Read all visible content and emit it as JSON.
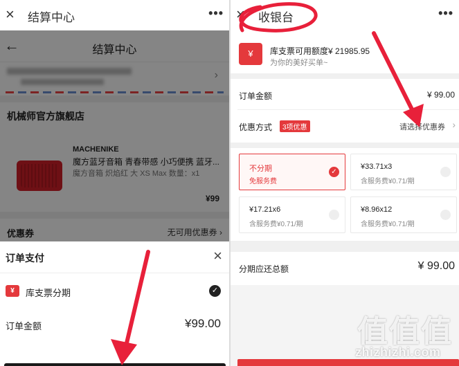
{
  "left": {
    "topbar": {
      "close_icon": "×",
      "title": "结算中心",
      "more_icon": "•••"
    },
    "header": {
      "back_icon": "←",
      "title": "结算中心"
    },
    "address": {
      "chevron": "›"
    },
    "shop_name": "机械师官方旗舰店",
    "product": {
      "brand": "MACHENIKE",
      "name": "魔方蓝牙音箱 青春带感 小巧便携 蓝牙...",
      "spec": "魔方音箱 炽焰红 大 XS Max    数量：x1",
      "price": "¥99"
    },
    "coupon": {
      "label": "优惠券",
      "value": "无可用优惠券 ›"
    },
    "payment_sheet": {
      "title": "订单支付",
      "close_icon": "×",
      "method_icon": "¥",
      "method": "库支票分期",
      "check_icon": "✓",
      "order_label": "订单金额",
      "order_amount": "¥99.00"
    }
  },
  "right": {
    "topbar": {
      "close_icon": "×",
      "title": "收银台",
      "more_icon": "•••"
    },
    "cashier": {
      "icon": "¥",
      "credit_text": "库支票可用额度¥ 21985.95",
      "subtitle": "为你的美好买单~"
    },
    "order_label": "订单金额",
    "order_amount": "¥ 99.00",
    "discount_label": "优惠方式",
    "discount_badge": "3项优惠",
    "discount_select": "请选择优惠券",
    "discount_chevron": "›",
    "plans": [
      {
        "title": "不分期",
        "sub": "免服务费",
        "selected": true,
        "radio": "✓"
      },
      {
        "title": "¥33.71x3",
        "sub": "含服务费¥0.71/期",
        "selected": false,
        "radio": ""
      },
      {
        "title": "¥17.21x6",
        "sub": "含服务费¥0.71/期",
        "selected": false,
        "radio": ""
      },
      {
        "title": "¥8.96x12",
        "sub": "含服务费¥0.71/期",
        "selected": false,
        "radio": ""
      }
    ],
    "total_label": "分期应还总额",
    "total_amount": "¥ 99.00"
  },
  "watermark": {
    "logo": "值值值",
    "text": "zhizhizhi.com"
  },
  "colors": {
    "accent": "#e4393c",
    "annotation": "#e8203a"
  }
}
